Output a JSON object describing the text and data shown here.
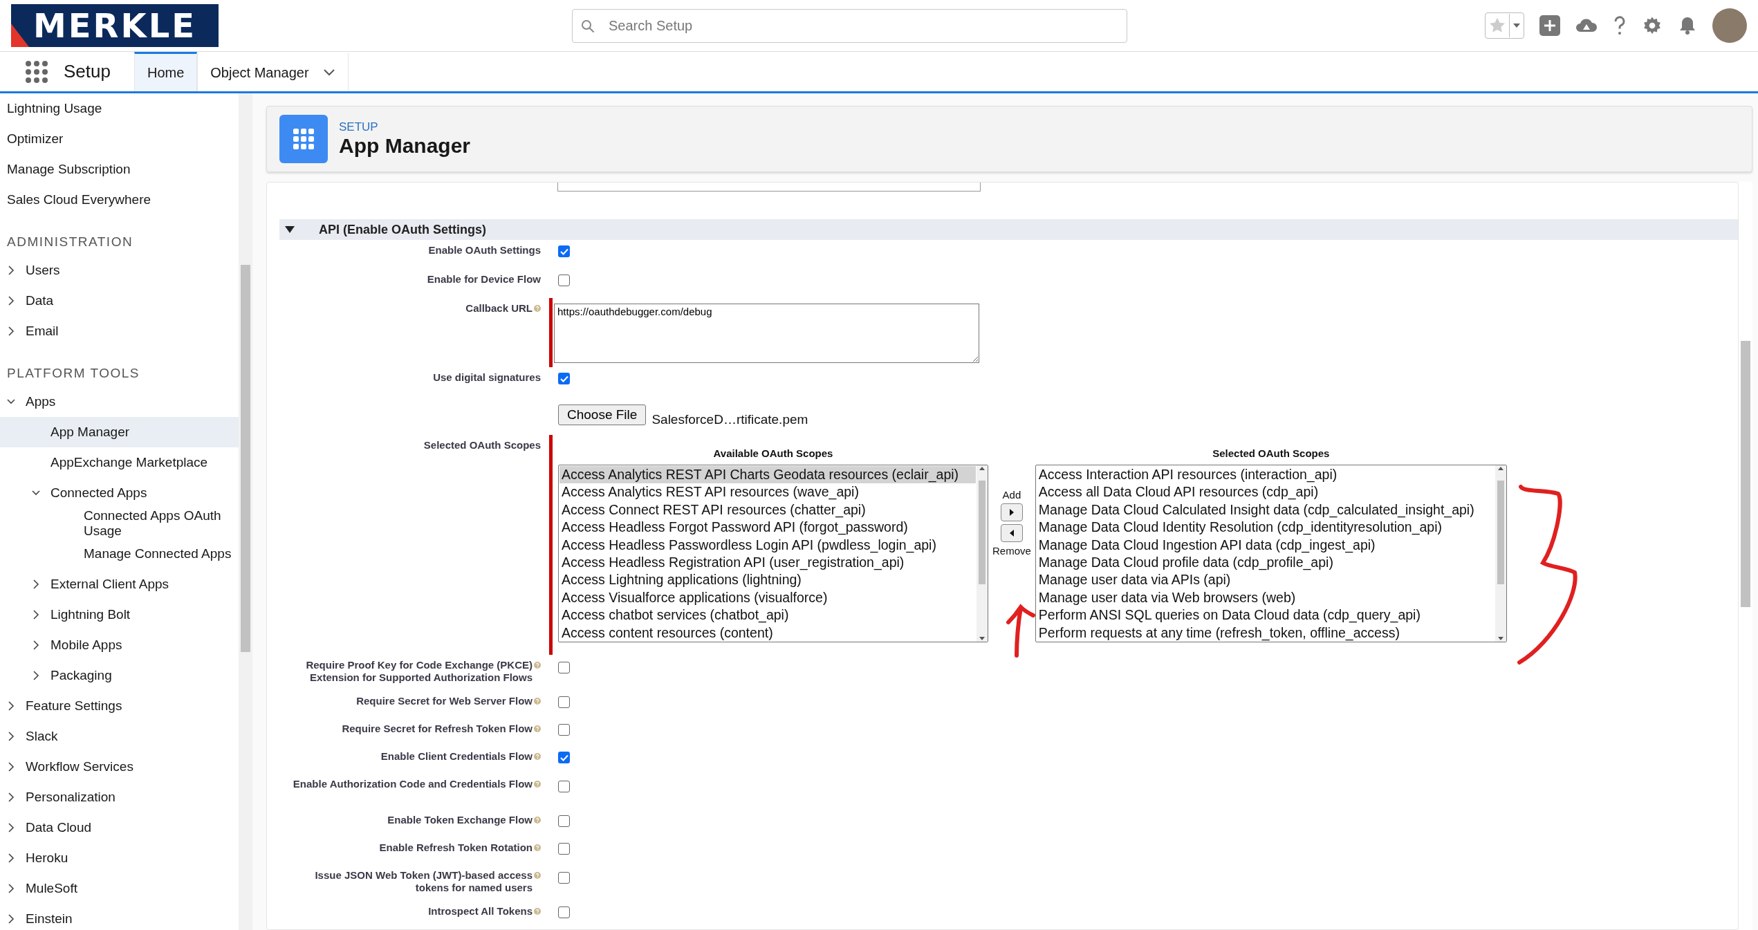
{
  "header": {
    "logo": "MERKLE",
    "search": {
      "placeholder": "Search Setup"
    }
  },
  "nav": {
    "app_name": "Setup",
    "tabs": [
      {
        "label": "Home",
        "selected": true,
        "dropdown": false
      },
      {
        "label": "Object Manager",
        "selected": false,
        "dropdown": true
      }
    ]
  },
  "sidebar": {
    "items": [
      {
        "kind": "link",
        "label": "Lightning Usage",
        "selected": false
      },
      {
        "kind": "link",
        "label": "Optimizer",
        "selected": false
      },
      {
        "kind": "link",
        "label": "Manage Subscription",
        "selected": false
      },
      {
        "kind": "link",
        "label": "Sales Cloud Everywhere",
        "selected": false
      },
      {
        "kind": "heading",
        "label": "ADMINISTRATION"
      },
      {
        "kind": "node",
        "label": "Users",
        "expanded": false
      },
      {
        "kind": "node",
        "label": "Data",
        "expanded": false
      },
      {
        "kind": "node",
        "label": "Email",
        "expanded": false
      },
      {
        "kind": "heading",
        "label": "PLATFORM TOOLS"
      },
      {
        "kind": "node",
        "label": "Apps",
        "expanded": true,
        "children": [
          {
            "kind": "link",
            "label": "App Manager",
            "selected": true
          },
          {
            "kind": "link",
            "label": "AppExchange Marketplace",
            "selected": false
          },
          {
            "kind": "node",
            "label": "Connected Apps",
            "expanded": true,
            "children": [
              {
                "kind": "link",
                "label": "Connected Apps OAuth Usage",
                "selected": false
              },
              {
                "kind": "link",
                "label": "Manage Connected Apps",
                "selected": false
              }
            ]
          },
          {
            "kind": "node",
            "label": "External Client Apps",
            "expanded": false
          },
          {
            "kind": "node",
            "label": "Lightning Bolt",
            "expanded": false
          },
          {
            "kind": "node",
            "label": "Mobile Apps",
            "expanded": false
          },
          {
            "kind": "node",
            "label": "Packaging",
            "expanded": false
          }
        ]
      },
      {
        "kind": "node",
        "label": "Feature Settings",
        "expanded": false
      },
      {
        "kind": "node",
        "label": "Slack",
        "expanded": false
      },
      {
        "kind": "node",
        "label": "Workflow Services",
        "expanded": false
      },
      {
        "kind": "node",
        "label": "Personalization",
        "expanded": false
      },
      {
        "kind": "node",
        "label": "Data Cloud",
        "expanded": false
      },
      {
        "kind": "node",
        "label": "Heroku",
        "expanded": false
      },
      {
        "kind": "node",
        "label": "MuleSoft",
        "expanded": false
      },
      {
        "kind": "node",
        "label": "Einstein",
        "expanded": false
      }
    ]
  },
  "page_header": {
    "eyebrow": "SETUP",
    "title": "App Manager"
  },
  "section": {
    "title": "API (Enable OAuth Settings)",
    "expanded": true
  },
  "fields": [
    {
      "kind": "checkbox",
      "label": "Enable OAuth Settings",
      "help": false,
      "checked": true
    },
    {
      "kind": "checkbox",
      "label": "Enable for Device Flow",
      "help": false,
      "checked": false
    },
    {
      "kind": "textarea",
      "label": "Callback URL",
      "help": true,
      "required": true,
      "value": "https://oauthdebugger.com/debug"
    },
    {
      "kind": "checkbox",
      "label": "Use digital signatures",
      "help": false,
      "checked": true
    },
    {
      "kind": "file",
      "button": "Choose File",
      "file_name": "SalesforceD…rtificate.pem"
    },
    {
      "kind": "scopes",
      "label": "Selected OAuth Scopes",
      "help": false,
      "required": true,
      "available": {
        "heading": "Available OAuth Scopes",
        "options": [
          {
            "label": "Access Analytics REST API Charts Geodata resources (eclair_api)",
            "selected": true
          },
          {
            "label": "Access Analytics REST API resources (wave_api)",
            "selected": false
          },
          {
            "label": "Access Connect REST API resources (chatter_api)",
            "selected": false
          },
          {
            "label": "Access Headless Forgot Password API (forgot_password)",
            "selected": false
          },
          {
            "label": "Access Headless Passwordless Login API (pwdless_login_api)",
            "selected": false
          },
          {
            "label": "Access Headless Registration API (user_registration_api)",
            "selected": false
          },
          {
            "label": "Access Lightning applications (lightning)",
            "selected": false
          },
          {
            "label": "Access Visualforce applications (visualforce)",
            "selected": false
          },
          {
            "label": "Access chatbot services (chatbot_api)",
            "selected": false
          },
          {
            "label": "Access content resources (content)",
            "selected": false
          }
        ]
      },
      "add_label": "Add",
      "remove_label": "Remove",
      "chosen": {
        "heading": "Selected OAuth Scopes",
        "options": [
          {
            "label": "Access Interaction API resources (interaction_api)",
            "selected": false
          },
          {
            "label": "Access all Data Cloud API resources (cdp_api)",
            "selected": false
          },
          {
            "label": "Manage Data Cloud Calculated Insight data (cdp_calculated_insight_api)",
            "selected": false
          },
          {
            "label": "Manage Data Cloud Identity Resolution (cdp_identityresolution_api)",
            "selected": false
          },
          {
            "label": "Manage Data Cloud Ingestion API data (cdp_ingest_api)",
            "selected": false
          },
          {
            "label": "Manage Data Cloud profile data (cdp_profile_api)",
            "selected": false
          },
          {
            "label": "Manage user data via APIs (api)",
            "selected": false
          },
          {
            "label": "Manage user data via Web browsers (web)",
            "selected": false
          },
          {
            "label": "Perform ANSI SQL queries on Data Cloud data (cdp_query_api)",
            "selected": false
          },
          {
            "label": "Perform requests at any time (refresh_token, offline_access)",
            "selected": false
          }
        ]
      }
    },
    {
      "kind": "checkbox",
      "label": "Require Proof Key for Code Exchange (PKCE) Extension for Supported Authorization Flows",
      "help": true,
      "checked": false
    },
    {
      "kind": "checkbox",
      "label": "Require Secret for Web Server Flow",
      "help": true,
      "checked": false
    },
    {
      "kind": "checkbox",
      "label": "Require Secret for Refresh Token Flow",
      "help": true,
      "checked": false
    },
    {
      "kind": "checkbox",
      "label": "Enable Client Credentials Flow",
      "help": true,
      "checked": true
    },
    {
      "kind": "checkbox",
      "label": "Enable Authorization Code and Credentials Flow",
      "help": true,
      "checked": false
    },
    {
      "kind": "checkbox",
      "label": "Enable Token Exchange Flow",
      "help": true,
      "checked": false
    },
    {
      "kind": "checkbox",
      "label": "Enable Refresh Token Rotation",
      "help": true,
      "checked": false
    },
    {
      "kind": "checkbox",
      "label": "Issue JSON Web Token (JWT)-based access tokens for named users",
      "help": true,
      "checked": false
    },
    {
      "kind": "checkbox",
      "label": "Introspect All Tokens",
      "help": true,
      "checked": false
    }
  ]
}
